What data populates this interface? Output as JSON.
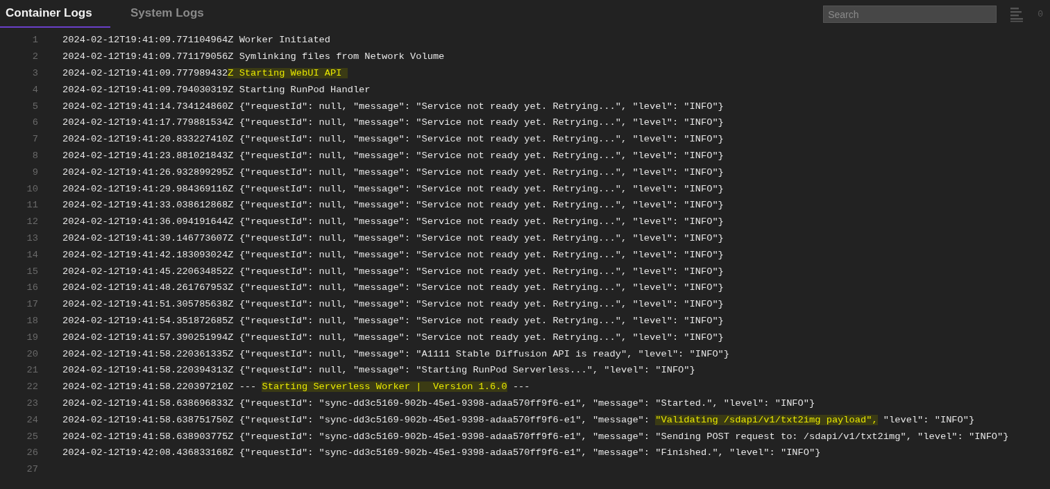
{
  "tabs": [
    {
      "label": "Container Logs",
      "selected": true
    },
    {
      "label": "System Logs",
      "selected": false
    }
  ],
  "search": {
    "placeholder": "Search"
  },
  "count": "0",
  "lines": [
    {
      "number": "1",
      "segments": [
        {
          "text": "2024-02-12T19:41:09.771104964Z Worker Initiated",
          "highlighted": false
        }
      ]
    },
    {
      "number": "2",
      "segments": [
        {
          "text": "2024-02-12T19:41:09.771179056Z Symlinking files from Network Volume",
          "highlighted": false
        }
      ]
    },
    {
      "number": "3",
      "segments": [
        {
          "text": "2024-02-12T19:41:09.777989432",
          "highlighted": false
        },
        {
          "text": "Z Starting WebUI API ",
          "highlighted": true
        }
      ]
    },
    {
      "number": "4",
      "segments": [
        {
          "text": "2024-02-12T19:41:09.794030319Z Starting RunPod Handler",
          "highlighted": false
        }
      ]
    },
    {
      "number": "5",
      "segments": [
        {
          "text": "2024-02-12T19:41:14.734124860Z {\"requestId\": null, \"message\": \"Service not ready yet. Retrying...\", \"level\": \"INFO\"}",
          "highlighted": false
        }
      ]
    },
    {
      "number": "6",
      "segments": [
        {
          "text": "2024-02-12T19:41:17.779881534Z {\"requestId\": null, \"message\": \"Service not ready yet. Retrying...\", \"level\": \"INFO\"}",
          "highlighted": false
        }
      ]
    },
    {
      "number": "7",
      "segments": [
        {
          "text": "2024-02-12T19:41:20.833227410Z {\"requestId\": null, \"message\": \"Service not ready yet. Retrying...\", \"level\": \"INFO\"}",
          "highlighted": false
        }
      ]
    },
    {
      "number": "8",
      "segments": [
        {
          "text": "2024-02-12T19:41:23.881021843Z {\"requestId\": null, \"message\": \"Service not ready yet. Retrying...\", \"level\": \"INFO\"}",
          "highlighted": false
        }
      ]
    },
    {
      "number": "9",
      "segments": [
        {
          "text": "2024-02-12T19:41:26.932899295Z {\"requestId\": null, \"message\": \"Service not ready yet. Retrying...\", \"level\": \"INFO\"}",
          "highlighted": false
        }
      ]
    },
    {
      "number": "10",
      "segments": [
        {
          "text": "2024-02-12T19:41:29.984369116Z {\"requestId\": null, \"message\": \"Service not ready yet. Retrying...\", \"level\": \"INFO\"}",
          "highlighted": false
        }
      ]
    },
    {
      "number": "11",
      "segments": [
        {
          "text": "2024-02-12T19:41:33.038612868Z {\"requestId\": null, \"message\": \"Service not ready yet. Retrying...\", \"level\": \"INFO\"}",
          "highlighted": false
        }
      ]
    },
    {
      "number": "12",
      "segments": [
        {
          "text": "2024-02-12T19:41:36.094191644Z {\"requestId\": null, \"message\": \"Service not ready yet. Retrying...\", \"level\": \"INFO\"}",
          "highlighted": false
        }
      ]
    },
    {
      "number": "13",
      "segments": [
        {
          "text": "2024-02-12T19:41:39.146773607Z {\"requestId\": null, \"message\": \"Service not ready yet. Retrying...\", \"level\": \"INFO\"}",
          "highlighted": false
        }
      ]
    },
    {
      "number": "14",
      "segments": [
        {
          "text": "2024-02-12T19:41:42.183093024Z {\"requestId\": null, \"message\": \"Service not ready yet. Retrying...\", \"level\": \"INFO\"}",
          "highlighted": false
        }
      ]
    },
    {
      "number": "15",
      "segments": [
        {
          "text": "2024-02-12T19:41:45.220634852Z {\"requestId\": null, \"message\": \"Service not ready yet. Retrying...\", \"level\": \"INFO\"}",
          "highlighted": false
        }
      ]
    },
    {
      "number": "16",
      "segments": [
        {
          "text": "2024-02-12T19:41:48.261767953Z {\"requestId\": null, \"message\": \"Service not ready yet. Retrying...\", \"level\": \"INFO\"}",
          "highlighted": false
        }
      ]
    },
    {
      "number": "17",
      "segments": [
        {
          "text": "2024-02-12T19:41:51.305785638Z {\"requestId\": null, \"message\": \"Service not ready yet. Retrying...\", \"level\": \"INFO\"}",
          "highlighted": false
        }
      ]
    },
    {
      "number": "18",
      "segments": [
        {
          "text": "2024-02-12T19:41:54.351872685Z {\"requestId\": null, \"message\": \"Service not ready yet. Retrying...\", \"level\": \"INFO\"}",
          "highlighted": false
        }
      ]
    },
    {
      "number": "19",
      "segments": [
        {
          "text": "2024-02-12T19:41:57.390251994Z {\"requestId\": null, \"message\": \"Service not ready yet. Retrying...\", \"level\": \"INFO\"}",
          "highlighted": false
        }
      ]
    },
    {
      "number": "20",
      "segments": [
        {
          "text": "2024-02-12T19:41:58.220361335Z {\"requestId\": null, \"message\": \"A1111 Stable Diffusion API is ready\", \"level\": \"INFO\"}",
          "highlighted": false
        }
      ]
    },
    {
      "number": "21",
      "segments": [
        {
          "text": "2024-02-12T19:41:58.220394313Z {\"requestId\": null, \"message\": \"Starting RunPod Serverless...\", \"level\": \"INFO\"}",
          "highlighted": false
        }
      ]
    },
    {
      "number": "22",
      "segments": [
        {
          "text": "2024-02-12T19:41:58.220397210Z --- ",
          "highlighted": false
        },
        {
          "text": "Starting Serverless Worker |  Version 1.6.0",
          "highlighted": true
        },
        {
          "text": " ---",
          "highlighted": false
        }
      ]
    },
    {
      "number": "23",
      "segments": [
        {
          "text": "2024-02-12T19:41:58.638696833Z {\"requestId\": \"sync-dd3c5169-902b-45e1-9398-adaa570ff9f6-e1\", \"message\": \"Started.\", \"level\": \"INFO\"}",
          "highlighted": false
        }
      ]
    },
    {
      "number": "24",
      "segments": [
        {
          "text": "2024-02-12T19:41:58.638751750Z {\"requestId\": \"sync-dd3c5169-902b-45e1-9398-adaa570ff9f6-e1\", \"message\": ",
          "highlighted": false
        },
        {
          "text": "\"Validating /sdapi/v1/txt2img payload\",",
          "highlighted": true
        },
        {
          "text": " \"level\": \"INFO\"}",
          "highlighted": false
        }
      ]
    },
    {
      "number": "25",
      "segments": [
        {
          "text": "2024-02-12T19:41:58.638903775Z {\"requestId\": \"sync-dd3c5169-902b-45e1-9398-adaa570ff9f6-e1\", \"message\": \"Sending POST request to: /sdapi/v1/txt2img\", \"level\": \"INFO\"}",
          "highlighted": false
        }
      ]
    },
    {
      "number": "26",
      "segments": [
        {
          "text": "2024-02-12T19:42:08.436833168Z {\"requestId\": \"sync-dd3c5169-902b-45e1-9398-adaa570ff9f6-e1\", \"message\": \"Finished.\", \"level\": \"INFO\"}",
          "highlighted": false
        }
      ]
    },
    {
      "number": "27"
    }
  ]
}
